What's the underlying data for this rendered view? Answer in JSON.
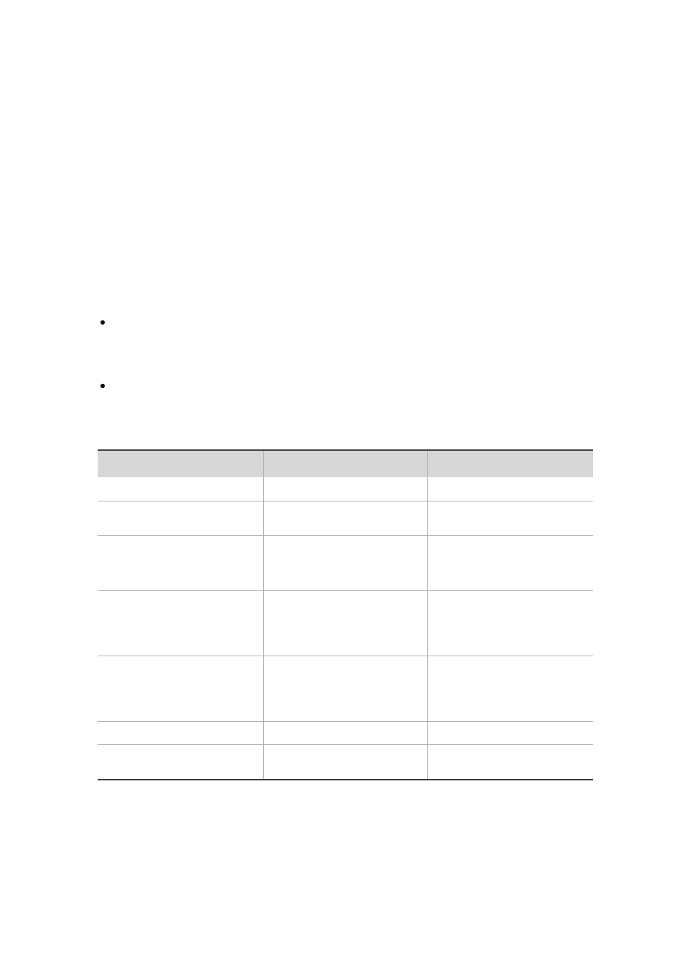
{
  "bullets": [
    "",
    ""
  ],
  "table": {
    "headers": [
      "",
      "",
      ""
    ],
    "rows": 7
  }
}
